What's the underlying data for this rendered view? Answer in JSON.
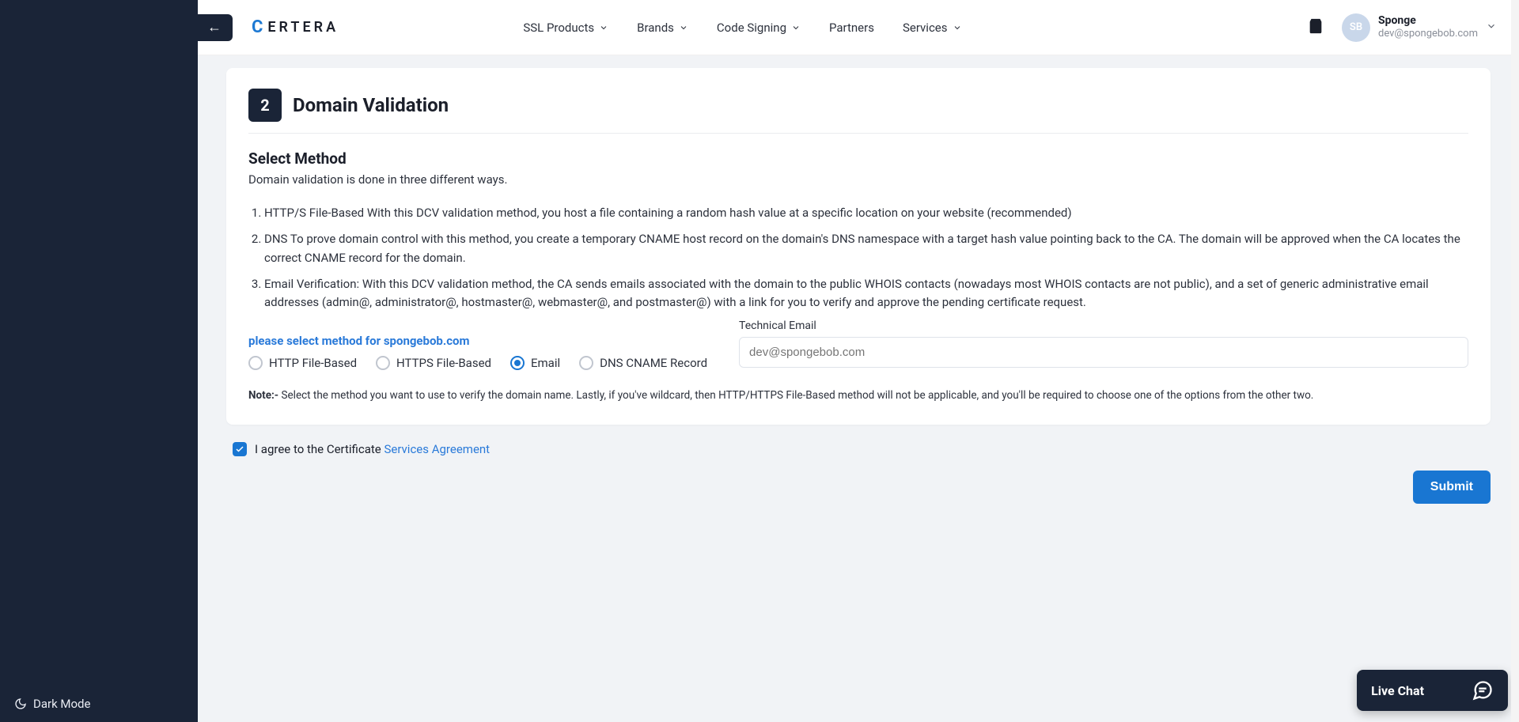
{
  "sidebar": {
    "dark_mode_label": "Dark Mode"
  },
  "back_arrow": "←",
  "logo": {
    "mark": "C",
    "rest": "ERTERA"
  },
  "nav": {
    "ssl_products": "SSL Products",
    "brands": "Brands",
    "code_signing": "Code Signing",
    "partners": "Partners",
    "services": "Services"
  },
  "user": {
    "initials": "SB",
    "name": "Sponge",
    "email": "dev@spongebob.com"
  },
  "step": {
    "number": "2",
    "title": "Domain Validation"
  },
  "section": {
    "title": "Select Method",
    "subtitle": "Domain validation is done in three different ways."
  },
  "methods_list": [
    "HTTP/S File-Based With this DCV validation method, you host a file containing a random hash value at a specific location on your website (recommended)",
    "DNS To prove domain control with this method, you create a temporary CNAME host record on the domain's DNS namespace with a target hash value pointing back to the CA. The domain will be approved when the CA locates the correct CNAME record for the domain.",
    "Email Verification: With this DCV validation method, the CA sends emails associated with the domain to the public WHOIS contacts (nowadays most WHOIS contacts are not public), and a set of generic administrative email addresses (admin@, administrator@, hostmaster@, webmaster@, and postmaster@) with a link for you to verify and approve the pending certificate request."
  ],
  "select_label": "please select method for spongebob.com",
  "radios": {
    "http": "HTTP File-Based",
    "https": "HTTPS File-Based",
    "email": "Email",
    "dns": "DNS CNAME Record",
    "selected": "email"
  },
  "tech_email": {
    "label": "Technical Email",
    "placeholder": "dev@spongebob.com"
  },
  "note": {
    "prefix": "Note:- ",
    "text": "Select the method you want to use to verify the domain name. Lastly, if you've wildcard, then HTTP/HTTPS File-Based method will not be applicable, and you'll be required to choose one of the options from the other two."
  },
  "agree": {
    "text_prefix": "I agree to the Certificate ",
    "link_text": "Services Agreement"
  },
  "submit_label": "Submit",
  "live_chat_label": "Live Chat"
}
